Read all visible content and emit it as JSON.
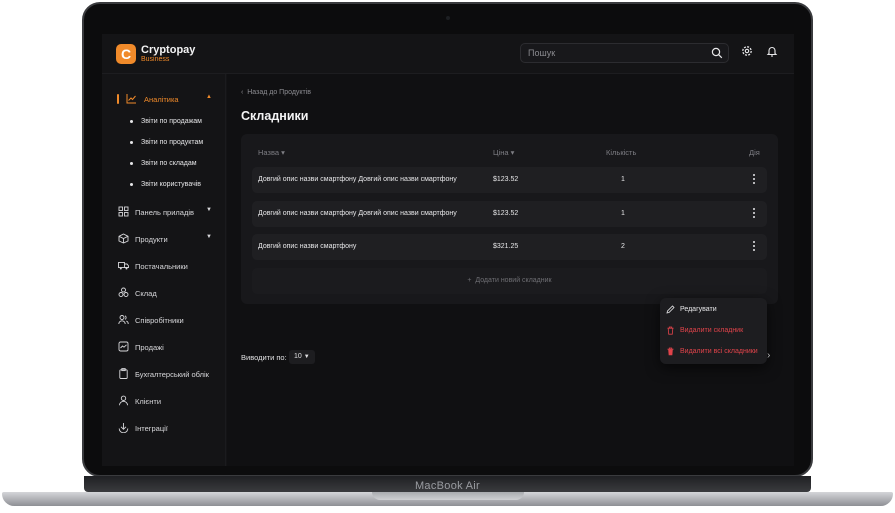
{
  "device": {
    "label": "MacBook Air"
  },
  "app": {
    "name": "Cryptopay",
    "subtitle": "Business",
    "logo_letter": "C",
    "accent": "#f08a2a",
    "danger": "#e0434a"
  },
  "header": {
    "search_placeholder": "Пошук",
    "icons": [
      "search-icon",
      "gear-icon",
      "bell-icon"
    ]
  },
  "sidebar": {
    "items": [
      {
        "label": "Аналітика",
        "icon": "chart-icon",
        "active": true
      },
      {
        "label": "Панель приладів",
        "icon": "dashboard-icon"
      },
      {
        "label": "Продукти",
        "icon": "box-icon"
      },
      {
        "label": "Постачальники",
        "icon": "truck-icon"
      },
      {
        "label": "Склад",
        "icon": "warehouse-icon"
      },
      {
        "label": "Співробітники",
        "icon": "users-icon"
      },
      {
        "label": "Продажі",
        "icon": "sales-icon"
      },
      {
        "label": "Бухгалтерський облік",
        "icon": "clipboard-icon"
      },
      {
        "label": "Клієнти",
        "icon": "user-icon"
      },
      {
        "label": "Інтеграції",
        "icon": "integration-icon"
      }
    ],
    "analytics_sub": [
      "Звіти по продажам",
      "Звіти по продуктам",
      "Звіти по складам",
      "Звіти користувачів"
    ]
  },
  "main": {
    "back_link": "Назад до Продуктів",
    "title": "Складники",
    "table": {
      "columns": [
        "Назва",
        "Ціна",
        "Кількість",
        "Дія"
      ],
      "rows": [
        {
          "name": "Довгий опис назви смартфону Довгий опис назви смартфону",
          "price": "$123.52",
          "qty": "1"
        },
        {
          "name": "Довгий опис назви смартфону Довгий опис назви смартфону",
          "price": "$123.52",
          "qty": "1"
        },
        {
          "name": "Довгий опис назви смартфону",
          "price": "$321.25",
          "qty": "2"
        }
      ],
      "add_label": "Додати новий складник"
    },
    "pagination": {
      "rows_label": "Виводити по:",
      "rows_value": "10"
    },
    "context_menu": {
      "edit": "Редагувати",
      "delete": "Видалити складник",
      "delete_all": "Видалити всі складники"
    }
  }
}
